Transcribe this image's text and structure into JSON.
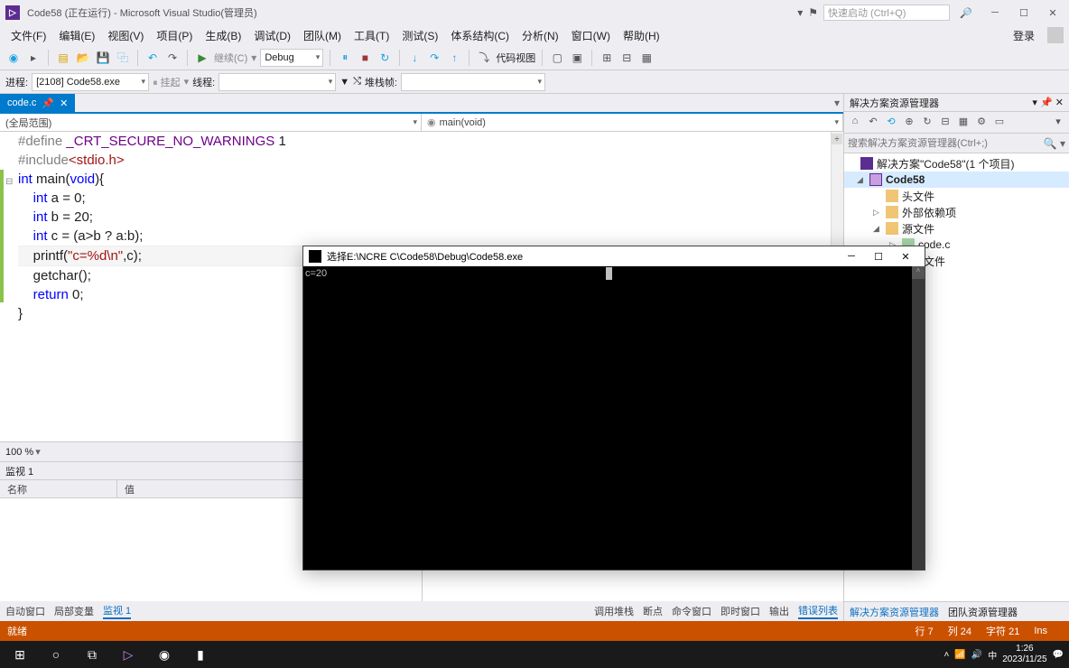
{
  "title": "Code58 (正在运行) - Microsoft Visual Studio(管理员)",
  "quicklaunch_placeholder": "快速启动 (Ctrl+Q)",
  "menu": [
    "文件(F)",
    "编辑(E)",
    "视图(V)",
    "项目(P)",
    "生成(B)",
    "调试(D)",
    "团队(M)",
    "工具(T)",
    "测试(S)",
    "体系结构(C)",
    "分析(N)",
    "窗口(W)",
    "帮助(H)"
  ],
  "login": "登录",
  "toolbar": {
    "continue": "继续(C)",
    "config": "Debug",
    "codeview": "代码视图"
  },
  "toolbar2": {
    "process_lbl": "进程:",
    "process": "[2108] Code58.exe",
    "suspend": "挂起",
    "thread_lbl": "线程:",
    "stackframe_lbl": "堆栈帧:"
  },
  "tab": {
    "name": "code.c",
    "pinned": true
  },
  "nav": {
    "scope": "(全局范围)",
    "func": "main(void)"
  },
  "code_lines": [
    {
      "html": "<span class='pp'>#define</span> <span class='def'>_CRT_SECURE_NO_WARNINGS</span> 1"
    },
    {
      "html": "<span class='pp'>#include</span><span class='inc'>&lt;stdio.h&gt;</span>"
    },
    {
      "html": "<span class='outline-marker'>⊟</span><span class='kw'>int</span> main(<span class='kw'>void</span>){"
    },
    {
      "html": "    <span class='kw'>int</span> a = 0;"
    },
    {
      "html": "    <span class='kw'>int</span> b = 20;"
    },
    {
      "html": "    <span class='kw'>int</span> c = (a&gt;b ? a:b);"
    },
    {
      "html": "    printf(<span class='str'>\"c=%d\\n\"</span>,c);",
      "hl": true
    },
    {
      "html": "    getchar();"
    },
    {
      "html": "    <span class='kw'>return</span> 0;"
    },
    {
      "html": "}"
    }
  ],
  "zoom": "100 %",
  "watch": {
    "title": "监视 1",
    "cols": [
      "名称",
      "值"
    ]
  },
  "bottom_tabs_left": [
    "自动窗口",
    "局部变量",
    "监视 1"
  ],
  "bottom_tabs_right": [
    "调用堆栈",
    "断点",
    "命令窗口",
    "即时窗口",
    "输出",
    "错误列表"
  ],
  "solution": {
    "panel_title": "解决方案资源管理器",
    "search_placeholder": "搜索解决方案资源管理器(Ctrl+;)",
    "root": "解决方案\"Code58\"(1 个项目)",
    "project": "Code58",
    "folders": [
      "头文件",
      "外部依赖项",
      "源文件",
      "资源文件"
    ],
    "source_file": "code.c"
  },
  "sp_tabs": [
    "解决方案资源管理器",
    "团队资源管理器"
  ],
  "status": {
    "state": "就绪",
    "line": "行 7",
    "col": "列 24",
    "char": "字符 21",
    "ins": "Ins"
  },
  "console": {
    "title": "选择E:\\NCRE C\\Code58\\Debug\\Code58.exe",
    "output": "c=20"
  },
  "taskbar": {
    "time": "1:26",
    "date": "2023/11/25",
    "ime": "中"
  }
}
